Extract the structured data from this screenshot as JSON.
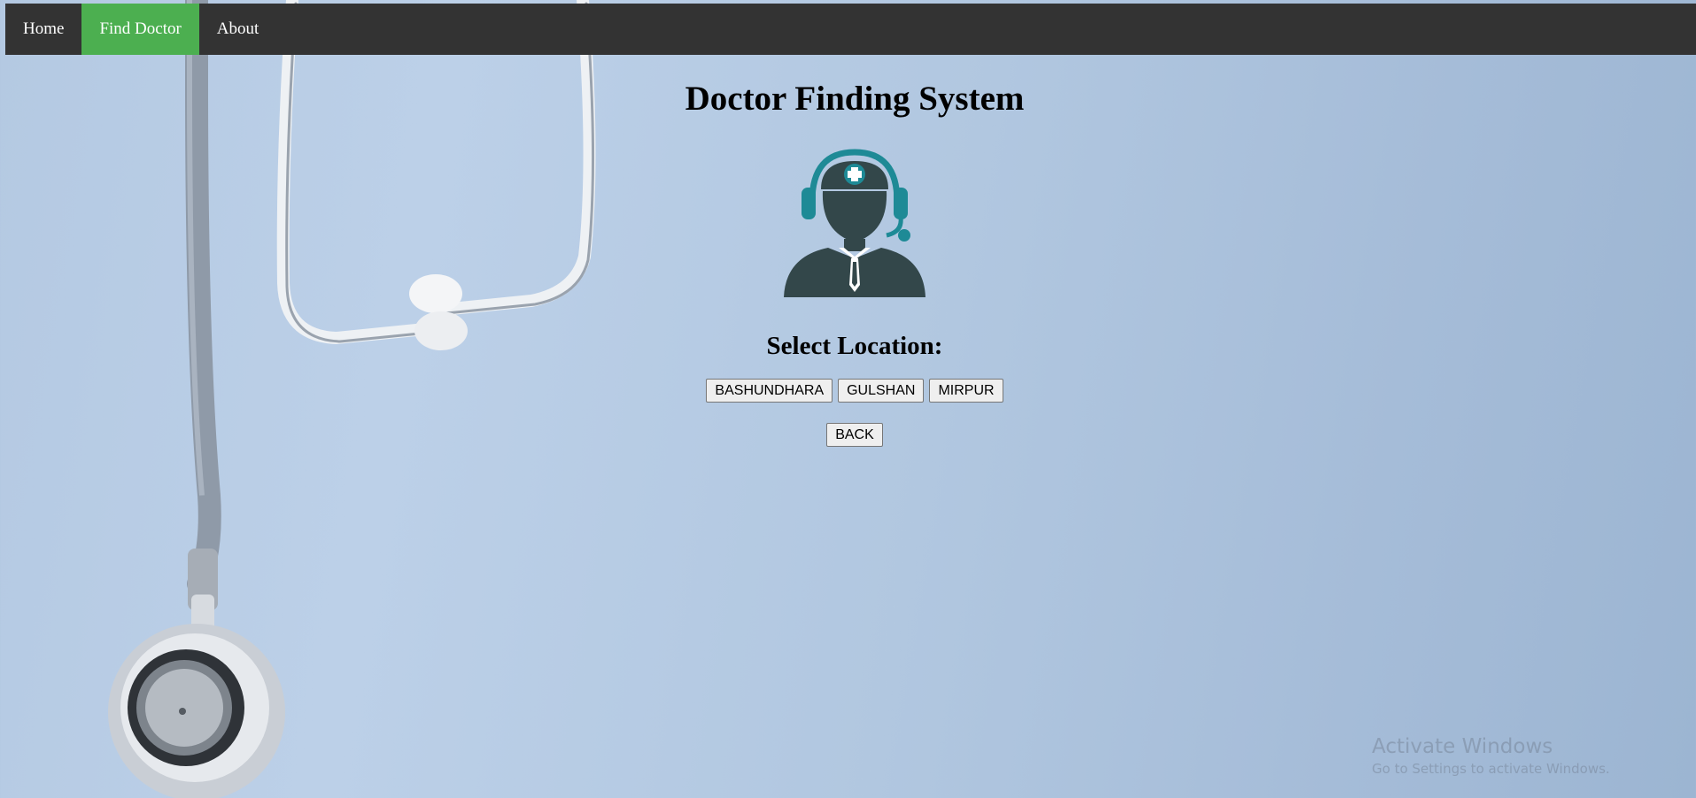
{
  "nav": {
    "items": [
      {
        "label": "Home",
        "active": false
      },
      {
        "label": "Find Doctor",
        "active": true
      },
      {
        "label": "About",
        "active": false
      }
    ],
    "active_color": "#4caf50",
    "bar_color": "#333333"
  },
  "main": {
    "title": "Doctor Finding System",
    "avatar_icon": "doctor-headset-icon",
    "location_heading": "Select Location:",
    "locations": [
      "BASHUNDHARA",
      "GULSHAN",
      "MIRPUR"
    ],
    "back_label": "BACK"
  },
  "watermark": {
    "title": "Activate Windows",
    "subtitle": "Go to Settings to activate Windows."
  },
  "colors": {
    "background": "#b4c9e2",
    "icon_dark": "#33474a",
    "icon_accent": "#1e8a96"
  }
}
